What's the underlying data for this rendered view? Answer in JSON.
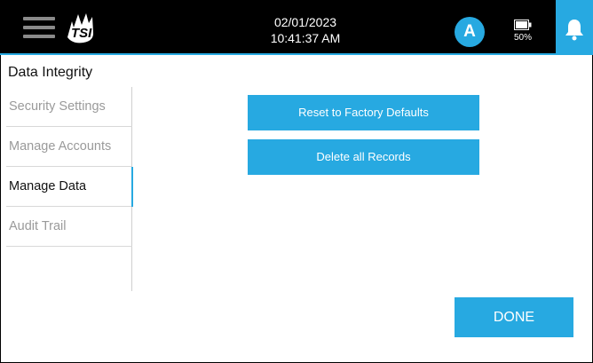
{
  "header": {
    "menu_icon": "hamburger-menu-icon",
    "logo_text": "TSI",
    "date": "02/01/2023",
    "time": "10:41:37 AM",
    "user_initial": "A",
    "battery_percent": "50%",
    "battery_level": 0.5,
    "notification_icon": "bell-icon",
    "accent_color": "#27a9e1",
    "bar_color": "#000000"
  },
  "page": {
    "title": "Data Integrity"
  },
  "sidebar": {
    "items": [
      {
        "label": "Security Settings",
        "active": false
      },
      {
        "label": "Manage Accounts",
        "active": false
      },
      {
        "label": "Manage Data",
        "active": true
      },
      {
        "label": "Audit Trail",
        "active": false
      }
    ]
  },
  "actions": {
    "reset_label": "Reset to Factory Defaults",
    "delete_label": "Delete all Records",
    "done_label": "DONE"
  }
}
